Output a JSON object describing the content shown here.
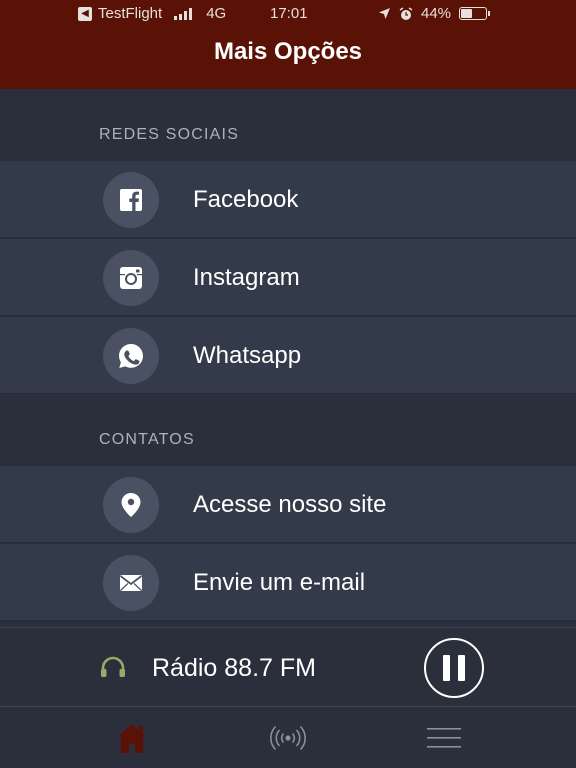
{
  "status_bar": {
    "carrier": "TestFlight",
    "network": "4G",
    "time": "17:01",
    "battery": "44%",
    "battery_level": 0.44
  },
  "header": {
    "title": "Mais Opções",
    "color": "#5a1206"
  },
  "sections": [
    {
      "title": "REDES SOCIAIS",
      "items": [
        {
          "label": "Facebook",
          "icon": "facebook-icon"
        },
        {
          "label": "Instagram",
          "icon": "instagram-icon"
        },
        {
          "label": "Whatsapp",
          "icon": "whatsapp-icon"
        }
      ]
    },
    {
      "title": "CONTATOS",
      "items": [
        {
          "label": "Acesse nosso site",
          "icon": "location-pin-icon"
        },
        {
          "label": "Envie um e-mail",
          "icon": "mail-icon"
        }
      ]
    }
  ],
  "player": {
    "station": "Rádio 88.7 FM",
    "icon": "headphones-icon",
    "icon_color": "#9aa86a",
    "state": "playing"
  },
  "tabbar": {
    "items": [
      {
        "icon": "home-icon",
        "active": true
      },
      {
        "icon": "radio-broadcast-icon",
        "active": false
      },
      {
        "icon": "menu-icon",
        "active": false
      }
    ],
    "active_color": "#5a1206",
    "inactive_color": "#8a90a0"
  }
}
